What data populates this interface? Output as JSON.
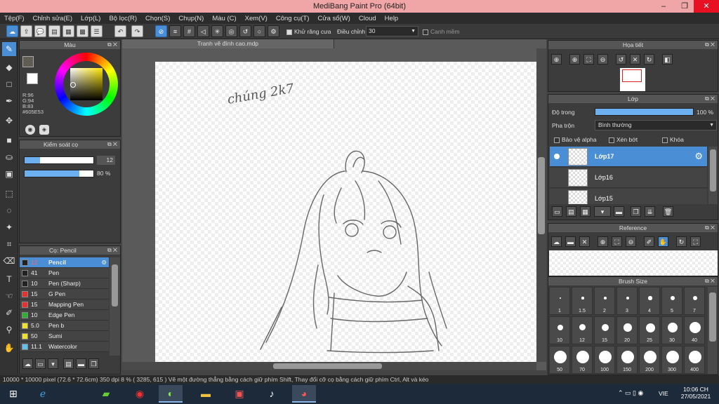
{
  "window": {
    "title": "MediBang Paint Pro (64bit)",
    "minimize": "–",
    "maximize": "❐",
    "close": "✕"
  },
  "menu": [
    "Tệp(F)",
    "Chỉnh sửa(E)",
    "Lớp(L)",
    "Bộ lọc(R)",
    "Chọn(S)",
    "Chụp(N)",
    "Màu (C)",
    "Xem(V)",
    "Công cụ(T)",
    "Cửa sổ(W)",
    "Cloud",
    "Help"
  ],
  "toolbar": {
    "antialias_label": "Khử răng cưa",
    "adjust_label": "Điều chỉnh",
    "adjust_value": "30",
    "smooth_label": "Canh mềm"
  },
  "color_panel": {
    "title": "Màu",
    "r": "R:96",
    "g": "G:94",
    "b": "B:83",
    "hex": "#605E53",
    "fg_color": "#605E53"
  },
  "brush_control": {
    "title": "Kiểm soát cọ",
    "size_value": "12",
    "opacity_value": "80 %",
    "size_fraction": 0.22,
    "opacity_fraction": 0.8
  },
  "brush_panel": {
    "title": "Cọ: Pencil",
    "items": [
      {
        "size": "12",
        "name": "Pencil",
        "color": "#222222"
      },
      {
        "size": "41",
        "name": "Pen",
        "color": "#222222"
      },
      {
        "size": "10",
        "name": "Pen (Sharp)",
        "color": "#222222"
      },
      {
        "size": "15",
        "name": "G Pen",
        "color": "#e83030"
      },
      {
        "size": "15",
        "name": "Mapping Pen",
        "color": "#e83030"
      },
      {
        "size": "10",
        "name": "Edge Pen",
        "color": "#30b030"
      },
      {
        "size": "5.0",
        "name": "Pen b",
        "color": "#f0e030"
      },
      {
        "size": "50",
        "name": "Sumi",
        "color": "#f0e030"
      },
      {
        "size": "11.1",
        "name": "Watercolor",
        "color": "#60c0f0"
      }
    ]
  },
  "document": {
    "tab_label": "Tranh vẽ đính cao.mdp"
  },
  "navigator": {
    "title": "Họa tiết"
  },
  "layer_panel": {
    "title": "Lớp",
    "opacity_label": "Độ trong",
    "opacity_value": "100 %",
    "opacity_fraction": 1.0,
    "blend_label": "Pha trộn",
    "blend_value": "Bình thường",
    "protect_alpha": "Bảo vệ alpha",
    "clipping": "Xén bớt",
    "lock": "Khóa",
    "layers": [
      "Lớp17",
      "Lớp16",
      "Lớp15"
    ]
  },
  "reference_panel": {
    "title": "Reference"
  },
  "brush_size_panel": {
    "title": "Brush Size",
    "sizes": [
      "1",
      "1.5",
      "2",
      "3",
      "4",
      "5",
      "7",
      "10",
      "12",
      "15",
      "20",
      "25",
      "30",
      "40",
      "50",
      "70",
      "100",
      "150",
      "200",
      "300",
      "400"
    ]
  },
  "statusbar": {
    "text": "10000 * 10000 pixel   (72.6 * 72.6cm)   350 dpi   8 %   ( 3285, 615 )   Vẽ một đường thẳng bằng cách giữ phím Shift, Thay đổi cỡ cọ bằng cách giữ phím Ctrl, Alt và kéo"
  },
  "taskbar": {
    "lang": "VIE",
    "time": "10:06 CH",
    "date": "27/05/2021"
  },
  "canvas": {
    "handwriting": "chúng 2k7"
  }
}
